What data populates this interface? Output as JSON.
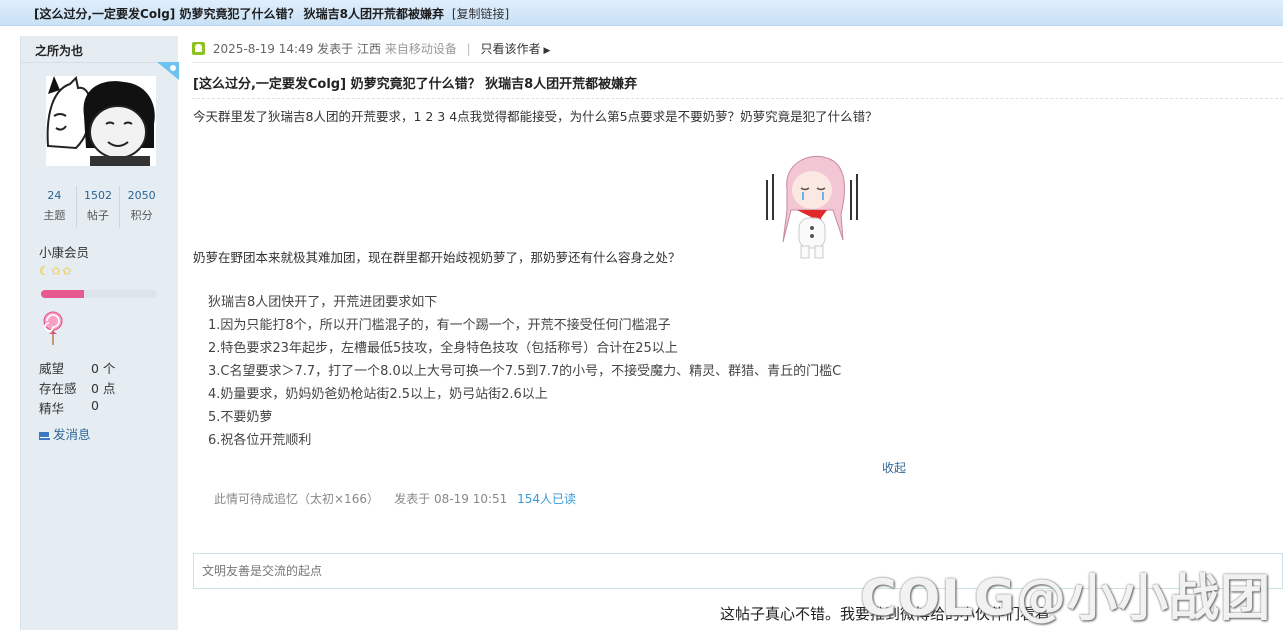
{
  "title_bar": {
    "title": "[这么过分,一定要发Colg] 奶萝究竟犯了什么错？ 狄瑞吉8人团开荒都被嫌弃",
    "copy_link": "[复制链接]"
  },
  "author": {
    "name": "之所为也",
    "stats": [
      {
        "value": "24",
        "label": "主题"
      },
      {
        "value": "1502",
        "label": "帖子"
      },
      {
        "value": "2050",
        "label": "积分"
      }
    ],
    "rank": "小康会员",
    "rank_stars": "☾✩✩",
    "rank_progress": 0.37,
    "fields": [
      {
        "label": "威望",
        "value": "0 个"
      },
      {
        "label": "存在感",
        "value": "0 点"
      },
      {
        "label": "精华",
        "value": "0"
      }
    ],
    "send_message": "发消息"
  },
  "post": {
    "date": "2025-8-19 14:49",
    "posted_in": "发表于 江西",
    "from_mobile": "来自移动设备",
    "only_author": "只看该作者",
    "title": "[这么过分,一定要发Colg] 奶萝究竟犯了什么错？ 狄瑞吉8人团开荒都被嫌弃",
    "paragraph1": "今天群里发了狄瑞吉8人团的开荒要求，1 2 3 4点我觉得都能接受，为什么第5点要求是不要奶萝？奶萝究竟是犯了什么错？",
    "paragraph2": "奶萝在野团本来就极其难加团，现在群里都开始歧视奶萝了，那奶萝还有什么容身之处？",
    "requirements": [
      "狄瑞吉8人团快开了，开荒进团要求如下",
      "1.因为只能打8个，所以开门槛混子的，有一个踢一个，开荒不接受任何门槛混子",
      "2.特色要求23年起步，左槽最低5技攻，全身特色技攻（包括称号）合计在25以上",
      "3.C名望要求＞7.7，打了一个8.0以上大号可换一个7.5到7.7的小号，不接受魔力、精灵、群猎、青丘的门槛C",
      "4.奶量要求，奶妈奶爸奶枪站街2.5以上，奶弓站街2.6以上",
      "5.不要奶萝",
      "6.祝各位开荒顺利"
    ],
    "collapse": "收起",
    "signature": "此情可待成追忆（太初×166）",
    "sig_time": "发表于 08-19 10:51",
    "reads": "154人已读"
  },
  "reply_box": {
    "placeholder": "文明友善是交流的起点"
  },
  "share_text": "这帖子真心不错。我要推到微博给的小伙伴们看看：",
  "watermark": "COLG@小小战团"
}
